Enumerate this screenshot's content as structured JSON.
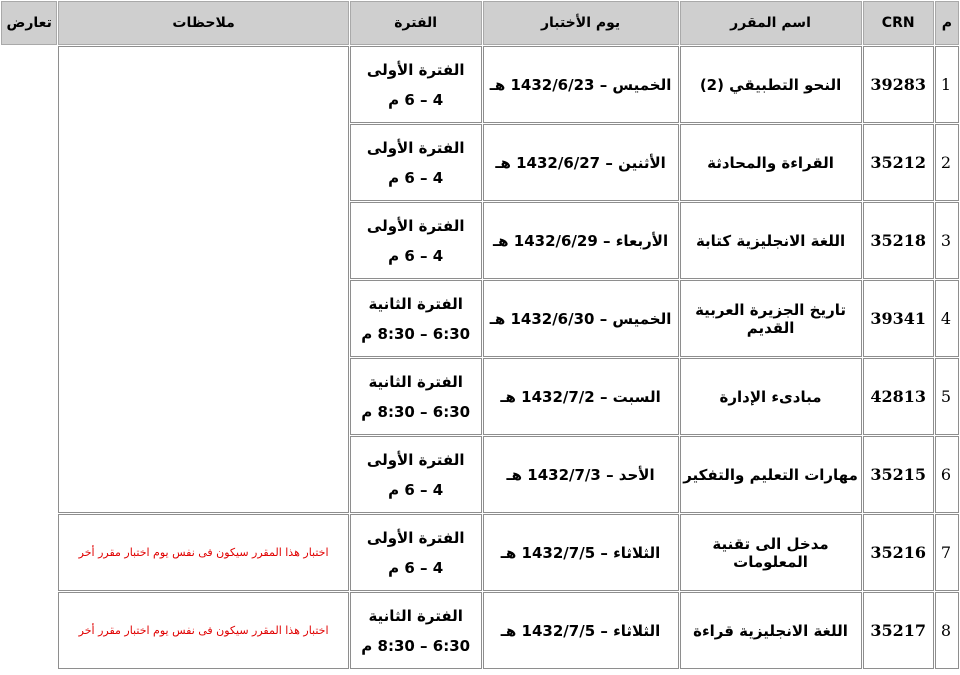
{
  "headers": {
    "num": "م",
    "crn": "CRN",
    "course": "اسم المقرر",
    "day": "يوم الأختبار",
    "period": "الفترة",
    "notes": "ملاحظات",
    "conflict": "تعارض"
  },
  "rows": [
    {
      "num": "1",
      "crn": "39283",
      "course": "النحو التطبيقي (2)",
      "day": "الخميس – 1432/6/23 هـ",
      "period_name": "الفترة الأولى",
      "period_time": "4 – 6 م",
      "note": ""
    },
    {
      "num": "2",
      "crn": "35212",
      "course": "القراءة والمحادثة",
      "day": "الأثنين – 1432/6/27 هـ",
      "period_name": "الفترة الأولى",
      "period_time": "4 – 6 م",
      "note": ""
    },
    {
      "num": "3",
      "crn": "35218",
      "course": "اللغة الانجليزية كتابة",
      "day": "الأربعاء – 1432/6/29 هـ",
      "period_name": "الفترة الأولى",
      "period_time": "4 – 6 م",
      "note": ""
    },
    {
      "num": "4",
      "crn": "39341",
      "course": "تاريخ الجزيرة العربية القديم",
      "day": "الخميس – 1432/6/30 هـ",
      "period_name": "الفترة الثانية",
      "period_time": "6:30 – 8:30 م",
      "note": ""
    },
    {
      "num": "5",
      "crn": "42813",
      "course": "مبادىء الإدارة",
      "day": "السبت – 1432/7/2 هـ",
      "period_name": "الفترة الثانية",
      "period_time": "6:30 – 8:30 م",
      "note": ""
    },
    {
      "num": "6",
      "crn": "35215",
      "course": "مهارات التعليم والتفكير",
      "day": "الأحد – 1432/7/3 هـ",
      "period_name": "الفترة الأولى",
      "period_time": "4 – 6 م",
      "note": ""
    },
    {
      "num": "7",
      "crn": "35216",
      "course": "مدخل الى تقنية المعلومات",
      "day": "الثلاثاء – 1432/7/5 هـ",
      "period_name": "الفترة الأولى",
      "period_time": "4 – 6 م",
      "note": "اختبار هذا المقرر سيكون فى نفس يوم اختبار مقرر أخر"
    },
    {
      "num": "8",
      "crn": "35217",
      "course": "اللغة الانجليزية قراءة",
      "day": "الثلاثاء – 1432/7/5 هـ",
      "period_name": "الفترة الثانية",
      "period_time": "6:30 – 8:30 م",
      "note": "اختبار هذا المقرر سيكون فى نفس يوم اختبار مقرر أخر"
    }
  ],
  "colors": {
    "header_bg": "#cfcfcf",
    "note_text": "#e00000",
    "border": "#8e8e8e"
  }
}
